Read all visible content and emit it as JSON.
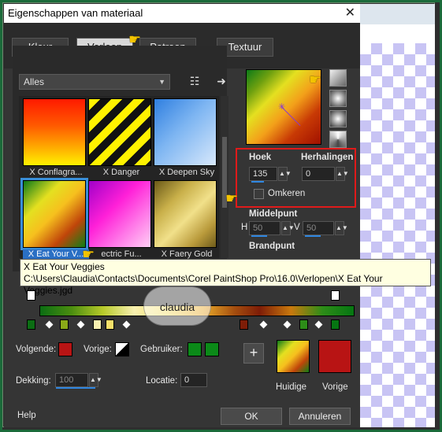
{
  "window": {
    "title": "Eigenschappen van materiaal",
    "close_label": "✕"
  },
  "tabs": [
    {
      "label": "Kleur"
    },
    {
      "label": "Verloop"
    },
    {
      "label": "Patroon"
    },
    {
      "label": "Textuur"
    }
  ],
  "library": {
    "category": "Alles",
    "thumbnails": [
      {
        "label": "X Conflagra..."
      },
      {
        "label": "X Danger"
      },
      {
        "label": "X Deepen Sky"
      },
      {
        "label": "X Eat Your V..."
      },
      {
        "label": "ectric Fu..."
      },
      {
        "label": "X Faery Gold"
      }
    ]
  },
  "params": {
    "hoek_label": "Hoek",
    "hoek_value": "135",
    "herhalingen_label": "Herhalingen",
    "herhalingen_value": "0",
    "omkeren_label": "Omkeren",
    "middelpunt_label": "Middelpunt",
    "h_label": "H",
    "h_value": "50",
    "v_label": "V",
    "v_value": "50",
    "brandpunt_label": "Brandpunt"
  },
  "tooltip": {
    "line1": "X Eat Your Veggies",
    "line2": "C:\\Users\\Claudia\\Contacts\\Documents\\Corel PaintShop Pro\\16.0\\Verlopen\\X Eat Your Veggies.jgd"
  },
  "watermark_text": "claudia",
  "bottom": {
    "volgende_label": "Volgende:",
    "vorige_label": "Vorige:",
    "gebruiker_label": "Gebruiker:",
    "dekking_label": "Dekking:",
    "dekking_value": "100",
    "locatie_label": "Locatie:",
    "locatie_value": "0",
    "huidige_label": "Huidige",
    "vorige_swatch_label": "Vorige",
    "help_label": "Help",
    "ok_label": "OK",
    "annuleren_label": "Annuleren",
    "add_label": "+"
  },
  "colors": {
    "volgende": "#b81414",
    "vorige_swatch": "#b81414",
    "gebruiker_1": "#0b8a18",
    "gebruiker_2": "#0b8a18",
    "accent_red": "#e01a1a",
    "accent_blue": "#2f86e0"
  }
}
